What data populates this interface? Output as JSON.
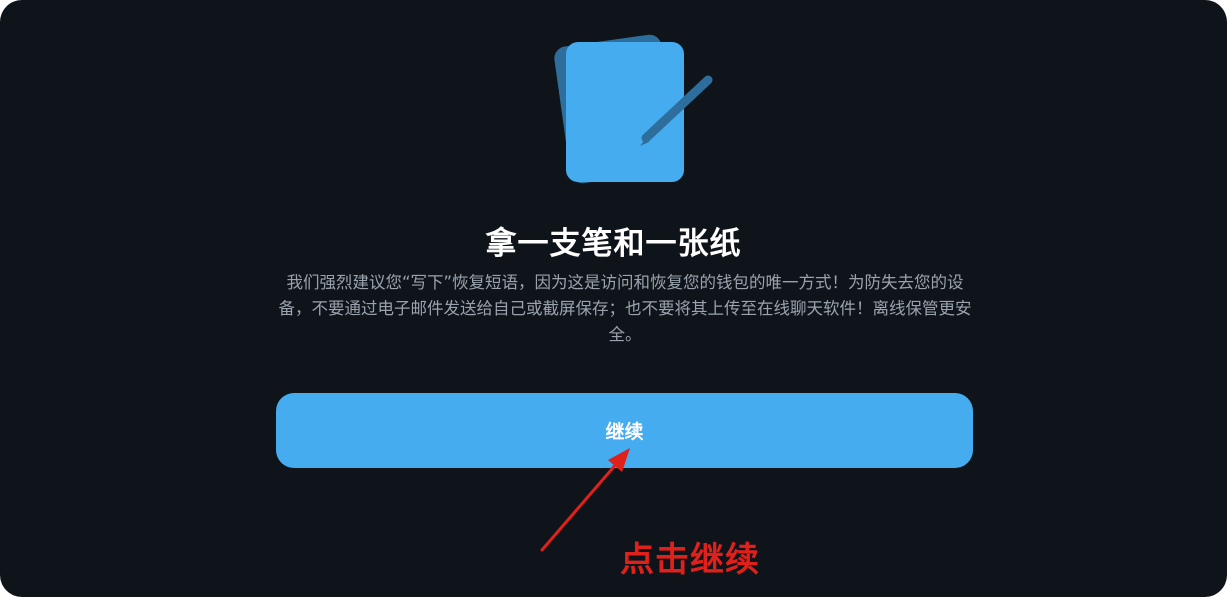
{
  "dialog": {
    "title": "拿一支笔和一张纸",
    "description": "我们强烈建议您“写下”恢复短语，因为这是访问和恢复您的钱包的唯一方式！为防失去您的设备，不要通过电子邮件发送给自己或截屏保存；也不要将其上传至在线聊天软件！离线保管更安全。",
    "continue_label": "继续",
    "illustration_icon": "paper-and-pen-icon"
  },
  "annotation": {
    "label": "点击继续",
    "color": "#e0201b"
  },
  "colors": {
    "background": "#0f141b",
    "accent": "#45acf0",
    "text_primary": "#ffffff",
    "text_secondary": "#9aa3ad"
  }
}
